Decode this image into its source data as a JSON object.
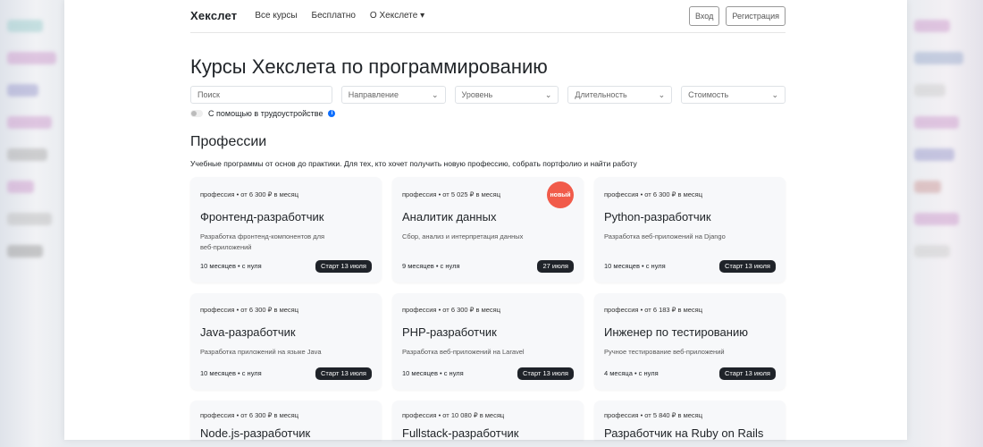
{
  "nav": {
    "logo": "Хекслет",
    "links": [
      "Все курсы",
      "Бесплатно",
      "О Хекслете ▾"
    ],
    "login": "Вход",
    "register": "Регистрация"
  },
  "title": "Курсы Хекслета по программированию",
  "filters": {
    "search_placeholder": "Поиск",
    "selects": [
      "Направление",
      "Уровень",
      "Длительность",
      "Стоимость"
    ]
  },
  "toggle_label": "С помощью в трудоустройстве",
  "section": {
    "title": "Профессии",
    "subtitle": "Учебные программы от основ до практики. Для тех, кто хочет получить новую профессию, собрать портфолио и найти работу"
  },
  "cards": [
    {
      "meta": "профессия  •  от 6 300 ₽ в месяц",
      "title": "Фронтенд-разработчик",
      "desc": "Разработка фронтенд-компонентов для веб-приложений",
      "info": "10 месяцев  •  с нуля",
      "start": "Старт 13 июля"
    },
    {
      "meta": "профессия  •  от 5 025 ₽ в месяц",
      "title": "Аналитик данных",
      "desc": "Сбор, анализ и интерпретация данных",
      "info": "9 месяцев  •  с нуля",
      "start": "27 июля",
      "badge": "новый"
    },
    {
      "meta": "профессия  •  от 6 300 ₽ в месяц",
      "title": "Python-разработчик",
      "desc": "Разработка веб-приложений на Django",
      "info": "10 месяцев  •  с нуля",
      "start": "Старт 13 июля"
    },
    {
      "meta": "профессия  •  от 6 300 ₽ в месяц",
      "title": "Java-разработчик",
      "desc": "Разработка приложений на языке Java",
      "info": "10 месяцев  •  с нуля",
      "start": "Старт 13 июля"
    },
    {
      "meta": "профессия  •  от 6 300 ₽ в месяц",
      "title": "PHP-разработчик",
      "desc": "Разработка веб-приложений на Laravel",
      "info": "10 месяцев  •  с нуля",
      "start": "Старт 13 июля"
    },
    {
      "meta": "профессия  •  от 6 183 ₽ в месяц",
      "title": "Инженер по тестированию",
      "desc": "Ручное тестирование веб-приложений",
      "info": "4 месяца  •  с нуля",
      "start": "Старт 13 июля"
    },
    {
      "meta": "профессия  •  от 6 300 ₽ в месяц",
      "title": "Node.js-разработчик"
    },
    {
      "meta": "профессия  •  от 10 080 ₽ в месяц",
      "title": "Fullstack-разработчик"
    },
    {
      "meta": "профессия  •  от 5 840 ₽ в месяц",
      "title": "Разработчик на Ruby on Rails"
    }
  ]
}
